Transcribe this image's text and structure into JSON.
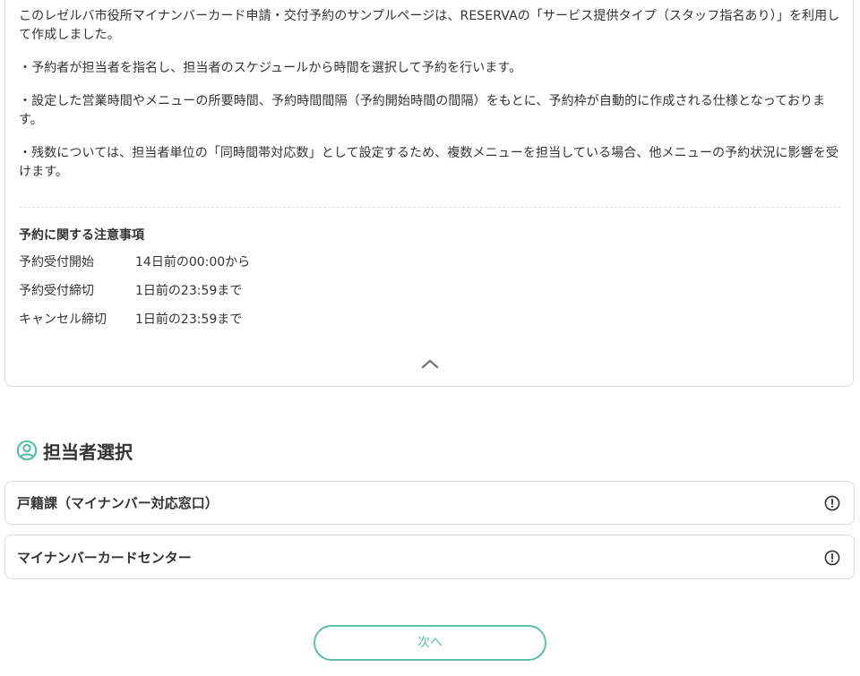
{
  "description": {
    "paragraphs": [
      "このレゼルバ市役所マイナンバーカード申請・交付予約のサンプルページは、RESERVAの「サービス提供タイプ（スタッフ指名あり）」を利用して作成しました。",
      "・予約者が担当者を指名し、担当者のスケジュールから時間を選択して予約を行います。",
      "・設定した営業時間やメニューの所要時間、予約時間間隔（予約開始時間の間隔）をもとに、予約枠が自動的に作成される仕様となっております。",
      "・残数については、担当者単位の「同時間帯対応数」として設定するため、複数メニューを担当している場合、他メニューの予約状況に影響を受けます。"
    ]
  },
  "notice": {
    "title": "予約に関する注意事項",
    "rows": [
      {
        "label": "予約受付開始",
        "value": "14日前の00:00から"
      },
      {
        "label": "予約受付締切",
        "value": "1日前の23:59まで"
      },
      {
        "label": "キャンセル締切",
        "value": "1日前の23:59まで"
      }
    ]
  },
  "collapse_icon": "chevron-up-icon",
  "staff_section": {
    "title": "担当者選択",
    "icon": "user-circle-icon",
    "items": [
      {
        "name": "戸籍課（マイナンバー対応窓口）",
        "icon": "info-circle-icon"
      },
      {
        "name": "マイナンバーカードセンター",
        "icon": "info-circle-icon"
      }
    ]
  },
  "next_button": {
    "label": "次へ"
  },
  "colors": {
    "accent": "#5cbfaa",
    "text": "#333333",
    "border": "#dcdcdc"
  }
}
